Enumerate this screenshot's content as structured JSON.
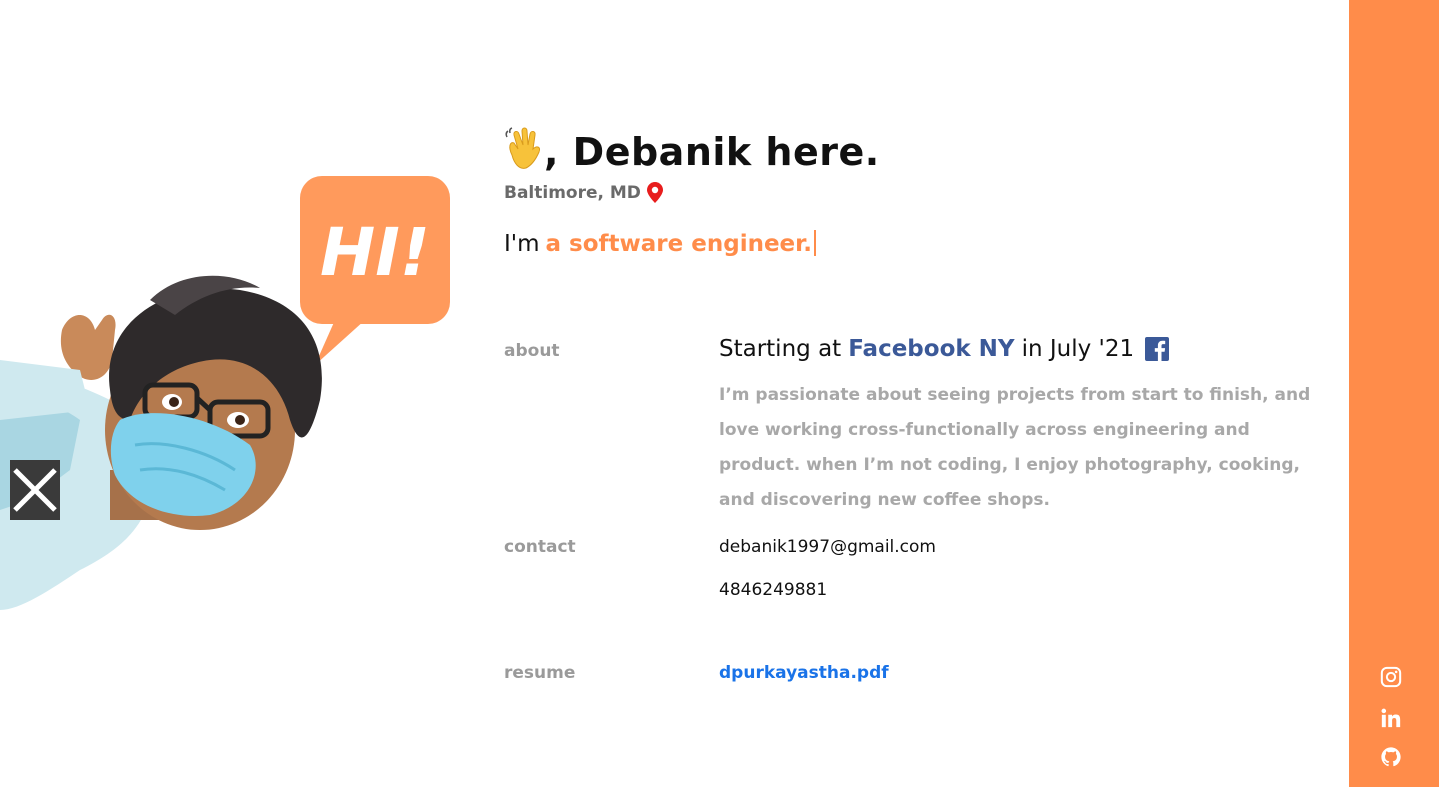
{
  "header": {
    "greeting": ", Debanik here.",
    "location": "Baltimore, MD",
    "tagline_prefix": "I'm",
    "tagline_typed": "a software engineer."
  },
  "illustration": {
    "bubble_text": "HI!"
  },
  "about": {
    "label": "about",
    "title_prefix": "Starting at",
    "company": "Facebook NY",
    "title_suffix": "in July '21",
    "body": "I’m passionate about seeing projects from start to finish, and love working cross-functionally across engineering and product. when I’m not coding, I enjoy photography, cooking, and discovering new coffee shops."
  },
  "contact": {
    "label": "contact",
    "email": "debanik1997@gmail.com",
    "phone": "4846249881"
  },
  "resume": {
    "label": "resume",
    "file": "dpurkayastha.pdf"
  },
  "social": {
    "icons": [
      "instagram-icon",
      "linkedin-icon",
      "github-icon"
    ]
  },
  "colors": {
    "accent": "#ff8c4a",
    "facebook": "#3b5998",
    "link": "#1a73e8",
    "muted": "#9a9a9a"
  }
}
